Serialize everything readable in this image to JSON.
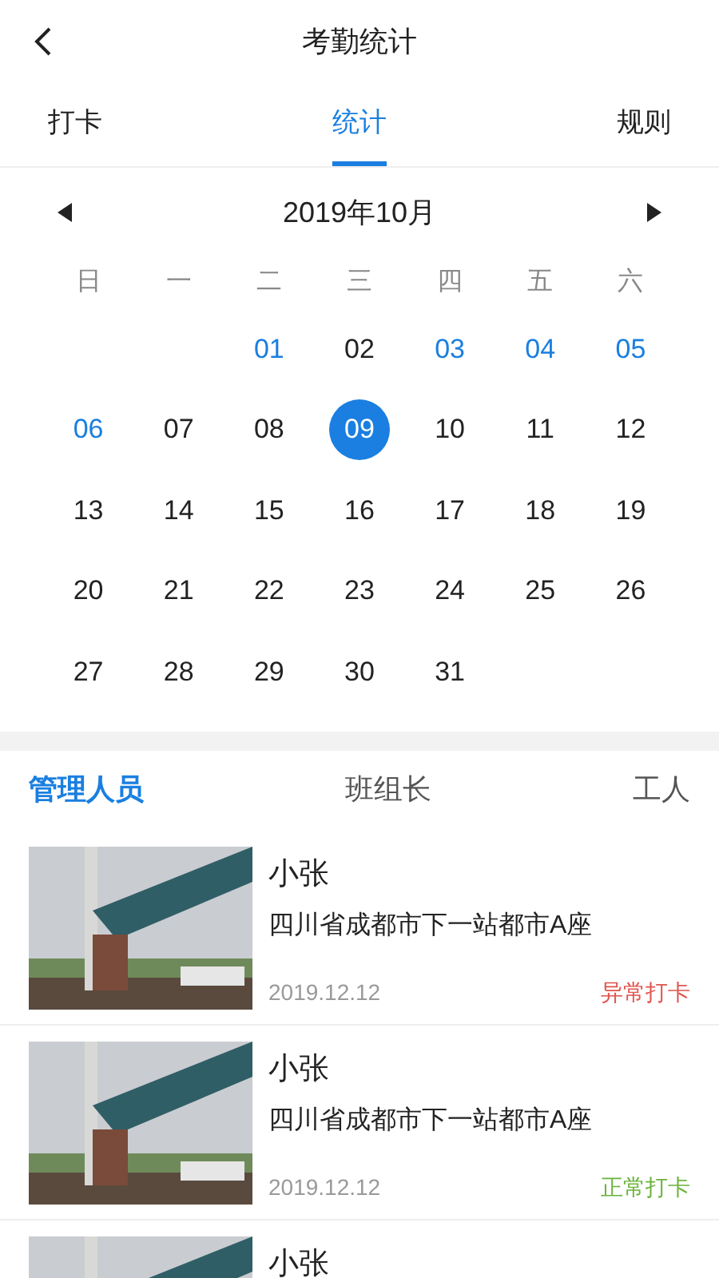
{
  "header": {
    "title": "考勤统计"
  },
  "tabs": [
    {
      "label": "打卡",
      "selected": false
    },
    {
      "label": "统计",
      "selected": true
    },
    {
      "label": "规则",
      "selected": false
    }
  ],
  "calendar": {
    "month": "2019年10月",
    "weekdays": [
      "日",
      "一",
      "二",
      "三",
      "四",
      "五",
      "六"
    ],
    "weeks": [
      [
        {
          "day": "01",
          "marked": true,
          "selected": false
        },
        {
          "day": "02",
          "marked": false,
          "selected": false
        },
        {
          "day": "03",
          "marked": true,
          "selected": false
        },
        {
          "day": "04",
          "marked": true,
          "selected": false
        },
        {
          "day": "05",
          "marked": true,
          "selected": false
        }
      ],
      [
        {
          "day": "06",
          "marked": true,
          "selected": false
        },
        {
          "day": "07",
          "marked": false,
          "selected": false
        },
        {
          "day": "08",
          "marked": false,
          "selected": false
        },
        {
          "day": "09",
          "marked": false,
          "selected": true
        },
        {
          "day": "10",
          "marked": false,
          "selected": false
        },
        {
          "day": "11",
          "marked": false,
          "selected": false
        },
        {
          "day": "12",
          "marked": false,
          "selected": false
        }
      ],
      [
        {
          "day": "13",
          "marked": false,
          "selected": false
        },
        {
          "day": "14",
          "marked": false,
          "selected": false
        },
        {
          "day": "15",
          "marked": false,
          "selected": false
        },
        {
          "day": "16",
          "marked": false,
          "selected": false
        },
        {
          "day": "17",
          "marked": false,
          "selected": false
        },
        {
          "day": "18",
          "marked": false,
          "selected": false
        },
        {
          "day": "19",
          "marked": false,
          "selected": false
        }
      ],
      [
        {
          "day": "20",
          "marked": false,
          "selected": false
        },
        {
          "day": "21",
          "marked": false,
          "selected": false
        },
        {
          "day": "22",
          "marked": false,
          "selected": false
        },
        {
          "day": "23",
          "marked": false,
          "selected": false
        },
        {
          "day": "24",
          "marked": false,
          "selected": false
        },
        {
          "day": "25",
          "marked": false,
          "selected": false
        },
        {
          "day": "26",
          "marked": false,
          "selected": false
        }
      ],
      [
        {
          "day": "27",
          "marked": false,
          "selected": false
        },
        {
          "day": "28",
          "marked": false,
          "selected": false
        },
        {
          "day": "29",
          "marked": false,
          "selected": false
        },
        {
          "day": "30",
          "marked": false,
          "selected": false
        },
        {
          "day": "31",
          "marked": false,
          "selected": false
        }
      ]
    ]
  },
  "role_tabs": [
    {
      "label": "管理人员",
      "selected": true
    },
    {
      "label": "班组长",
      "selected": false
    },
    {
      "label": "工人",
      "selected": false
    }
  ],
  "records": [
    {
      "name": "小张",
      "address": "四川省成都市下一站都市A座",
      "date": "2019.12.12",
      "status": "异常打卡",
      "kind": "abnormal"
    },
    {
      "name": "小张",
      "address": "四川省成都市下一站都市A座",
      "date": "2019.12.12",
      "status": "正常打卡",
      "kind": "normal"
    },
    {
      "name": "小张"
    }
  ]
}
